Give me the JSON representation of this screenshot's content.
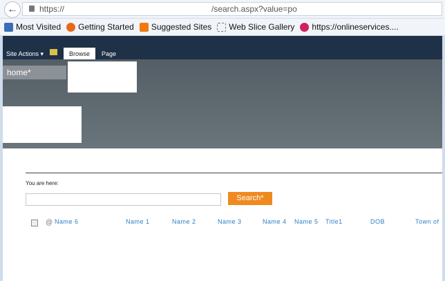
{
  "browser": {
    "url_scheme": "https://",
    "url_path": "/search.aspx?value=po",
    "bookmarks": [
      {
        "label": "Most Visited",
        "icon": "most-visited-icon",
        "color": "#3a6fb5"
      },
      {
        "label": "Getting Started",
        "icon": "firefox-icon",
        "color": "#e66a1a"
      },
      {
        "label": "Suggested Sites",
        "icon": "suggested-sites-icon",
        "color": "#f07a12"
      },
      {
        "label": "Web Slice Gallery",
        "icon": "web-slice-icon",
        "color": "#ffffff"
      },
      {
        "label": "https://onlineservices....",
        "icon": "dwf-icon",
        "color": "#d0215b"
      }
    ]
  },
  "ribbon": {
    "site_actions": "Site Actions",
    "tabs": [
      "Browse",
      "Page"
    ]
  },
  "nav": {
    "home": "home*"
  },
  "main": {
    "you_are_here": "You are here:",
    "search_value": "",
    "search_button": "Search*",
    "columns": [
      "Name 6",
      "Name 1",
      "Name 2",
      "Name 3",
      "Name 4",
      "Name 5",
      "Title1",
      "DOB",
      "Town of"
    ]
  },
  "colors": {
    "accent": "#ee8a1f",
    "link": "#2f7fc1",
    "ribbon": "#1f3147"
  }
}
